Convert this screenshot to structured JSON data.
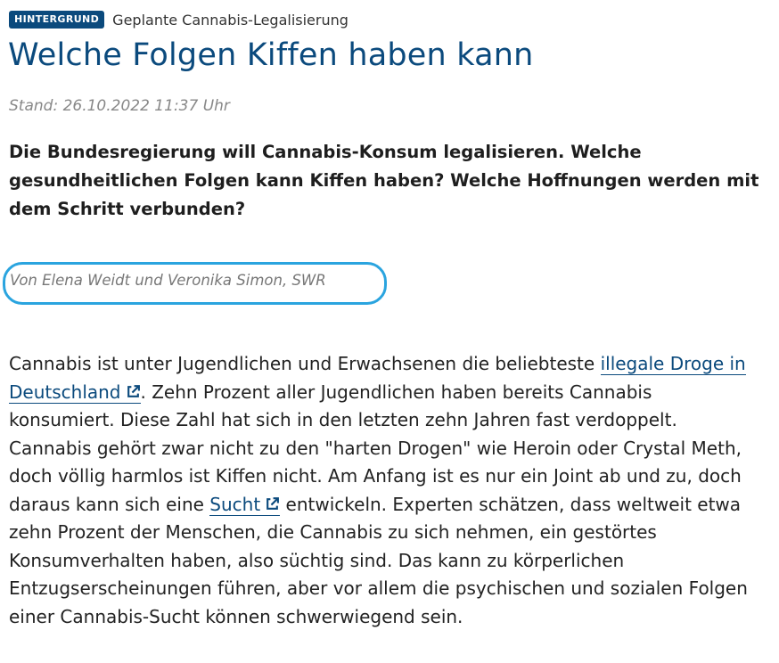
{
  "article": {
    "badge": "HINTERGRUND",
    "kicker": "Geplante Cannabis-Legalisierung",
    "headline": "Welche Folgen Kiffen haben kann",
    "date": "Stand: 26.10.2022 11:37 Uhr",
    "teaser": "Die Bundesregierung will Cannabis-Konsum legalisieren. Welche gesundheitlichen Folgen kann Kiffen haben? Welche Hoffnungen werden mit dem Schritt verbunden?",
    "author": "Von Elena Weidt und Veronika Simon, SWR",
    "body": {
      "part1": "Cannabis ist unter Jugendlichen und Erwachsenen die beliebteste ",
      "link1": "illegale Droge in Deutschland",
      "part2": ". Zehn Prozent aller Jugendlichen haben bereits Cannabis konsumiert. Diese Zahl hat sich in den letzten zehn Jahren fast verdoppelt. Cannabis gehört zwar nicht zu den \"harten Drogen\" wie Heroin oder Crystal Meth, doch völlig harmlos ist Kiffen nicht. Am Anfang ist es nur ein Joint ab und zu, doch daraus kann sich eine ",
      "link2": "Sucht",
      "part3": " entwickeln. Experten schätzen, dass weltweit etwa zehn Prozent der Menschen, die Cannabis zu sich nehmen, ein gestörtes Konsumverhalten haben, also süchtig sind. Das kann zu körperlichen Entzugserscheinungen führen, aber vor allem die psychischen und sozialen Folgen einer Cannabis-Sucht können schwerwiegend sein."
    }
  },
  "icons": {
    "external_link": "external-link-icon"
  },
  "colors": {
    "brand": "#0b4a7d",
    "highlight": "#2aa4df"
  }
}
